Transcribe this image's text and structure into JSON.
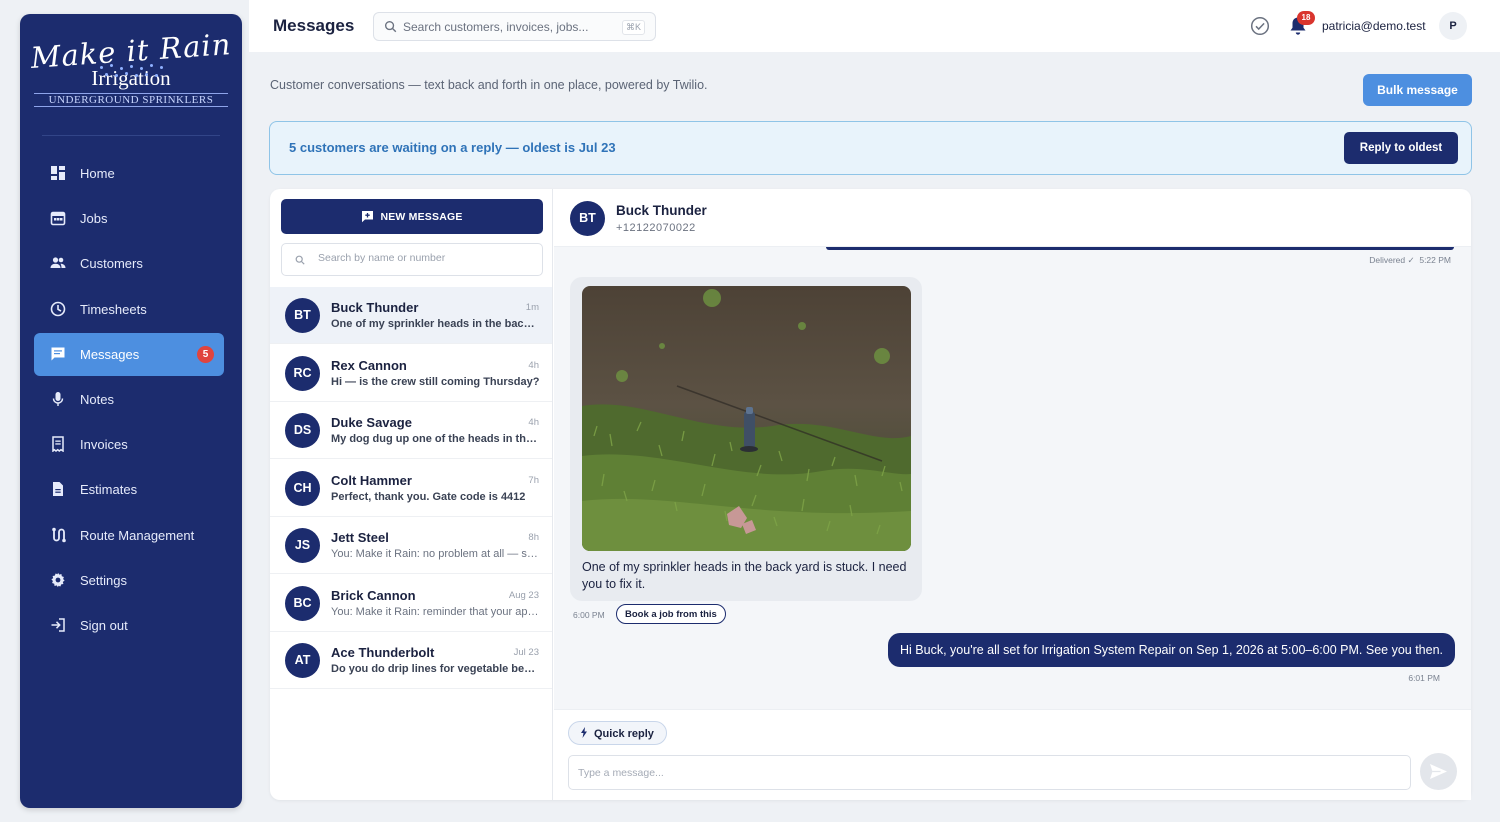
{
  "brand": {
    "logo_line1": "Make it Rain",
    "logo_line2": "Irrigation",
    "logo_line3": "UNDERGROUND SPRINKLERS"
  },
  "sidebar": {
    "items": [
      {
        "label": "Home",
        "icon": "dashboard-icon"
      },
      {
        "label": "Jobs",
        "icon": "calendar-icon"
      },
      {
        "label": "Customers",
        "icon": "people-icon"
      },
      {
        "label": "Timesheets",
        "icon": "clock-icon"
      },
      {
        "label": "Messages",
        "icon": "chat-icon",
        "active": true,
        "badge": "5"
      },
      {
        "label": "Notes",
        "icon": "microphone-icon"
      },
      {
        "label": "Invoices",
        "icon": "receipt-icon"
      },
      {
        "label": "Estimates",
        "icon": "document-icon"
      },
      {
        "label": "Route Management",
        "icon": "route-icon"
      },
      {
        "label": "Settings",
        "icon": "gear-icon"
      },
      {
        "label": "Sign out",
        "icon": "sign-out-icon"
      }
    ]
  },
  "header": {
    "title": "Messages",
    "search_placeholder": "Search customers, invoices, jobs...",
    "search_shortcut": "⌘K",
    "notification_count": "18",
    "user_email": "patricia@demo.test",
    "user_initial": "P"
  },
  "page": {
    "subtitle": "Customer conversations — text back and forth in one place, powered by Twilio.",
    "bulk_button": "Bulk message"
  },
  "banner": {
    "text": "5 customers are waiting on a reply — oldest is Jul 23",
    "button": "Reply to oldest"
  },
  "conversation_list": {
    "new_message_label": "NEW MESSAGE",
    "search_placeholder": "Search by name or number",
    "items": [
      {
        "initials": "BT",
        "name": "Buck Thunder",
        "time": "1m",
        "preview": "One of my sprinkler heads in the back yard is stuck. I need you to fix it.",
        "active": true,
        "from_you": false
      },
      {
        "initials": "RC",
        "name": "Rex Cannon",
        "time": "4h",
        "preview": "Hi — is the crew still coming Thursday?",
        "active": false,
        "from_you": false
      },
      {
        "initials": "DS",
        "name": "Duke Savage",
        "time": "4h",
        "preview": "My dog dug up one of the heads in the front yard",
        "active": false,
        "from_you": false
      },
      {
        "initials": "CH",
        "name": "Colt Hammer",
        "time": "7h",
        "preview": "Perfect, thank you. Gate code is 4412",
        "active": false,
        "from_you": false
      },
      {
        "initials": "JS",
        "name": "Jett Steel",
        "time": "8h",
        "preview": "You: Make it Rain: no problem at all — see you soon",
        "active": false,
        "from_you": true
      },
      {
        "initials": "BC",
        "name": "Brick Cannon",
        "time": "Aug 23",
        "preview": "You: Make it Rain: reminder that your appointment is tomorrow",
        "active": false,
        "from_you": true
      },
      {
        "initials": "AT",
        "name": "Ace Thunderbolt",
        "time": "Jul 23",
        "preview": "Do you do drip lines for vegetable beds?",
        "active": false,
        "from_you": false
      }
    ]
  },
  "chat": {
    "contact_initials": "BT",
    "contact_name": "Buck Thunder",
    "contact_phone": "+12122070022",
    "previous_status": "Delivered ✓",
    "previous_time": "5:22 PM",
    "incoming_text": "One of my sprinkler heads in the back yard is stuck. I need you to fix it.",
    "incoming_time": "6:00 PM",
    "book_job_label": "Book a job from this",
    "outgoing_text": "Hi Buck, you're all set for Irrigation System Repair on Sep 1, 2026 at 5:00–6:00 PM. See you then.",
    "outgoing_time": "6:01 PM",
    "quick_reply_label": "Quick reply",
    "input_placeholder": "Type a message..."
  },
  "colors": {
    "sidebar_bg": "#1c2c6e",
    "accent": "#4d8fe0",
    "badge": "#e0443e",
    "banner_bg": "#e8f3fb",
    "banner_text": "#2f73b8"
  }
}
